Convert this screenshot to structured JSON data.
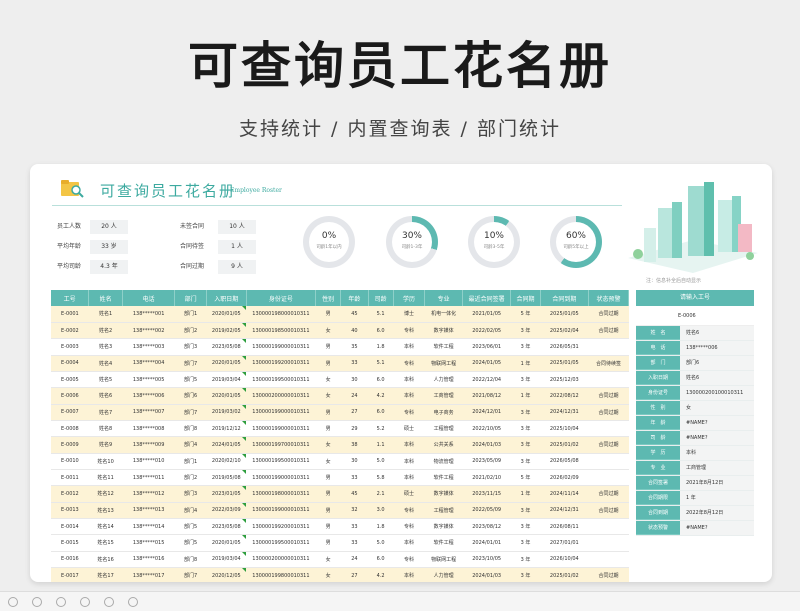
{
  "header": {
    "title": "可查询员工花名册",
    "subtitle": "支持统计 /  内置查询表  /  部门统计"
  },
  "card": {
    "title": "可查询员工花名册",
    "subtitle": "Employee Roster"
  },
  "stats": [
    {
      "label": "员工人数",
      "value": "20 人"
    },
    {
      "label": "平均年龄",
      "value": "33 岁"
    },
    {
      "label": "平均司龄",
      "value": "4.3 年"
    },
    {
      "label": "未签合同",
      "value": "10 人"
    },
    {
      "label": "合同待签",
      "value": "1 人"
    },
    {
      "label": "合同过期",
      "value": "9 人"
    }
  ],
  "rings": [
    {
      "pct": "0%",
      "label": "司龄1年以内",
      "fraction": 0
    },
    {
      "pct": "30%",
      "label": "司龄1-3年",
      "fraction": 0.3
    },
    {
      "pct": "10%",
      "label": "司龄3-5年",
      "fraction": 0.1
    },
    {
      "pct": "60%",
      "label": "司龄5年以上",
      "fraction": 0.6
    }
  ],
  "note": "注：信息补全后自动显示",
  "table": {
    "headers": [
      "工号",
      "姓名",
      "电话",
      "部门",
      "入职日期",
      "身份证号",
      "性别",
      "年龄",
      "司龄",
      "学历",
      "专业",
      "最近合同签署",
      "合同期",
      "合同到期",
      "状态预警"
    ],
    "rows": [
      [
        "E-0001",
        "姓名1",
        "138*****001",
        "部门1",
        "2020/01/05",
        "130000198000010311",
        "男",
        "45",
        "5.1",
        "博士",
        "机电一体化",
        "2021/01/05",
        "5 年",
        "2025/01/05",
        "合同过期"
      ],
      [
        "E-0002",
        "姓名2",
        "138*****002",
        "部门2",
        "2019/02/05",
        "130000198500010311",
        "女",
        "40",
        "6.0",
        "专科",
        "数字媒体",
        "2022/02/05",
        "3 年",
        "2025/02/04",
        "合同过期"
      ],
      [
        "E-0003",
        "姓名3",
        "138*****003",
        "部门3",
        "2023/05/08",
        "130000199000010311",
        "男",
        "35",
        "1.8",
        "本科",
        "软件工程",
        "2023/06/01",
        "3 年",
        "2026/05/31",
        ""
      ],
      [
        "E-0004",
        "姓名4",
        "138*****004",
        "部门7",
        "2020/01/05",
        "130000199200010311",
        "男",
        "33",
        "5.1",
        "专科",
        "物联网工程",
        "2024/01/05",
        "1 年",
        "2025/01/05",
        "合同待续签"
      ],
      [
        "E-0005",
        "姓名5",
        "138*****005",
        "部门5",
        "2019/03/04",
        "130000199500010311",
        "女",
        "30",
        "6.0",
        "本科",
        "人力管理",
        "2022/12/04",
        "3 年",
        "2025/12/03",
        ""
      ],
      [
        "E-0006",
        "姓名6",
        "138*****006",
        "部门6",
        "2020/01/05",
        "130000200000010311",
        "女",
        "24",
        "4.2",
        "本科",
        "工商管理",
        "2021/08/12",
        "1 年",
        "2022/08/12",
        "合同过期"
      ],
      [
        "E-0007",
        "姓名7",
        "138*****007",
        "部门7",
        "2019/03/02",
        "130000199000010311",
        "男",
        "27",
        "6.0",
        "专科",
        "电子商务",
        "2024/12/01",
        "3 年",
        "2024/12/31",
        "合同过期"
      ],
      [
        "E-0008",
        "姓名8",
        "138*****008",
        "部门8",
        "2019/12/12",
        "130000199000010311",
        "男",
        "29",
        "5.2",
        "硕士",
        "工程管理",
        "2022/10/05",
        "3 年",
        "2025/10/04",
        ""
      ],
      [
        "E-0009",
        "姓名9",
        "138*****009",
        "部门4",
        "2024/01/05",
        "130000199700010311",
        "女",
        "38",
        "1.1",
        "本科",
        "公共关系",
        "2024/01/03",
        "3 年",
        "2025/01/02",
        "合同过期"
      ],
      [
        "E-0010",
        "姓名10",
        "138*****010",
        "部门1",
        "2020/02/10",
        "130000199500010311",
        "女",
        "30",
        "5.0",
        "本科",
        "物流管理",
        "2023/05/09",
        "3 年",
        "2026/05/08",
        ""
      ],
      [
        "E-0011",
        "姓名11",
        "138*****011",
        "部门2",
        "2019/05/08",
        "130000199000010311",
        "男",
        "33",
        "5.8",
        "本科",
        "软件工程",
        "2021/02/10",
        "5 年",
        "2026/02/09",
        ""
      ],
      [
        "E-0012",
        "姓名12",
        "138*****012",
        "部门3",
        "2023/01/05",
        "130000198000010311",
        "男",
        "45",
        "2.1",
        "硕士",
        "数字媒体",
        "2023/11/15",
        "1 年",
        "2024/11/14",
        "合同过期"
      ],
      [
        "E-0013",
        "姓名13",
        "138*****013",
        "部门4",
        "2022/03/09",
        "130000199000010311",
        "男",
        "32",
        "3.0",
        "专科",
        "工程管理",
        "2022/05/09",
        "3 年",
        "2024/12/31",
        "合同过期"
      ],
      [
        "E-0014",
        "姓名14",
        "138*****014",
        "部门5",
        "2023/05/08",
        "130000199200010311",
        "男",
        "33",
        "1.8",
        "专科",
        "数字媒体",
        "2023/08/12",
        "3 年",
        "2026/08/11",
        ""
      ],
      [
        "E-0015",
        "姓名15",
        "138*****015",
        "部门5",
        "2020/01/05",
        "130000199500010311",
        "男",
        "33",
        "5.0",
        "本科",
        "软件工程",
        "2024/01/01",
        "3 年",
        "2027/01/01",
        ""
      ],
      [
        "E-0016",
        "姓名16",
        "138*****016",
        "部门8",
        "2019/03/04",
        "130000200000010311",
        "女",
        "24",
        "6.0",
        "专科",
        "物联网工程",
        "2023/10/05",
        "3 年",
        "2026/10/04",
        ""
      ],
      [
        "E-0017",
        "姓名17",
        "138*****017",
        "部门7",
        "2020/12/05",
        "130000199800010311",
        "女",
        "27",
        "4.2",
        "本科",
        "人力管理",
        "2024/01/03",
        "3 年",
        "2025/01/02",
        "合同过期"
      ]
    ]
  },
  "side": {
    "header": "请输入工号",
    "id": "E-0006",
    "fields": [
      {
        "k": "姓　名",
        "v": "姓名6"
      },
      {
        "k": "电　话",
        "v": "138*****006"
      },
      {
        "k": "部　门",
        "v": "部门6"
      },
      {
        "k": "入职日期",
        "v": "姓名6"
      },
      {
        "k": "身份证号",
        "v": "130000200100010311"
      },
      {
        "k": "性　别",
        "v": "女"
      },
      {
        "k": "年　龄",
        "v": "#NAME?"
      },
      {
        "k": "司　龄",
        "v": "#NAME?"
      },
      {
        "k": "学　历",
        "v": "本科"
      },
      {
        "k": "专　业",
        "v": "工商管理"
      },
      {
        "k": "合同签署",
        "v": "2021年8月12日"
      },
      {
        "k": "合同期限",
        "v": "1 年"
      },
      {
        "k": "合同到期",
        "v": "2022年8月12日"
      },
      {
        "k": "状态预警",
        "v": "#NAME?"
      }
    ]
  },
  "colors": {
    "accent": "#5db9b1",
    "row_highlight": "#fdf3d6"
  }
}
